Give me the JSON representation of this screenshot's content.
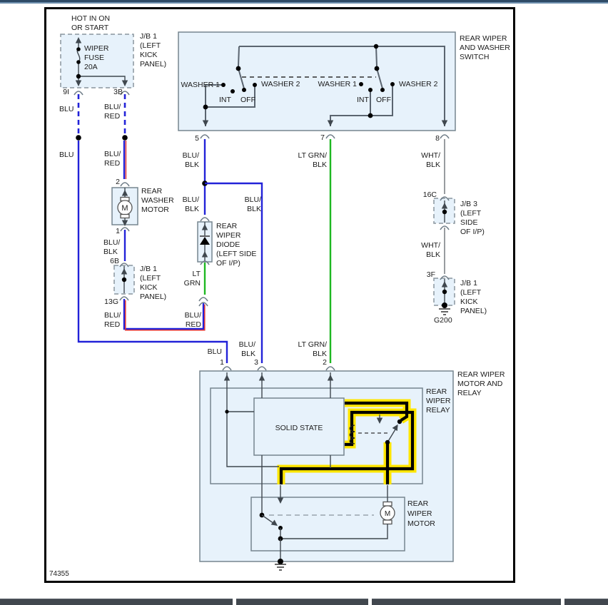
{
  "chrome": {
    "figure_number": "74355",
    "top_bar_color": "#2e4a66",
    "bottom_bar_color": "#41474e"
  },
  "colors": {
    "blu": "#2222d8",
    "red": "#e03434",
    "lt_grn": "#1eb822",
    "wht_blk": "#8c9196",
    "highlight_yellow": "#ffe600",
    "box_fill": "#e7f2fb",
    "box_stroke": "#76858f"
  },
  "power_source": {
    "note": [
      "HOT IN ON",
      "OR START"
    ],
    "fuse_label": [
      "WIPER",
      "FUSE",
      "20A"
    ],
    "block_label": [
      "J/B 1",
      "(LEFT",
      "KICK",
      "PANEL)"
    ],
    "pin_left": "9I",
    "pin_right": "3B"
  },
  "switch": {
    "title": [
      "REAR WIPER",
      "AND WASHER",
      "SWITCH"
    ],
    "left": {
      "washer1": "WASHER 1",
      "int": "INT",
      "off": "OFF",
      "washer2": "WASHER 2"
    },
    "right": {
      "washer1": "WASHER 1",
      "int": "INT",
      "off": "OFF",
      "washer2": "WASHER 2"
    },
    "pin5": "5",
    "pin7": "7",
    "pin8": "8"
  },
  "washer_motor": {
    "label": [
      "REAR",
      "WASHER",
      "MOTOR"
    ],
    "motor_letter": "M",
    "pin_top": "2",
    "pin_bottom": "1"
  },
  "jb1_mid": {
    "label": [
      "J/B 1",
      "(LEFT",
      "KICK",
      "PANEL)"
    ],
    "pin_top": "6B",
    "pin_bottom": "13G"
  },
  "diode": {
    "label": [
      "REAR",
      "WIPER",
      "DIODE",
      "(LEFT SIDE",
      "OF I/P)"
    ]
  },
  "jb3": {
    "label": [
      "J/B 3",
      "(LEFT",
      "SIDE",
      "OF I/P)"
    ],
    "pin_top": "16C"
  },
  "jb1_right": {
    "label": [
      "J/B 1",
      "(LEFT",
      "KICK",
      "PANEL)"
    ],
    "pin_top": "3F",
    "ground": "G200"
  },
  "relay_unit": {
    "title": [
      "REAR WIPER",
      "MOTOR AND",
      "RELAY"
    ],
    "relay_label": [
      "REAR",
      "WIPER",
      "RELAY"
    ],
    "solid_state": "SOLID STATE",
    "motor_label": [
      "REAR",
      "WIPER",
      "MOTOR"
    ],
    "motor_letter": "M",
    "pin1": "1",
    "pin3": "3",
    "pin2": "2"
  },
  "wire_labels": {
    "blu_top": "BLU",
    "blu_red_top": [
      "BLU/",
      "RED"
    ],
    "blu_mid": "BLU",
    "blu_red_mid": [
      "BLU/",
      "RED"
    ],
    "blu_blk_washer": [
      "BLU/",
      "BLK"
    ],
    "blu_red_13g": [
      "BLU/",
      "RED"
    ],
    "blu_red_conn": [
      "BLU/",
      "RED"
    ],
    "lt_grn": [
      "LT",
      "GRN"
    ],
    "blu_blk_pin5": [
      "BLU/",
      "BLK"
    ],
    "blu_blk_splice": [
      "BLU/",
      "BLK"
    ],
    "blu_blk_branch": [
      "BLU/",
      "BLK"
    ],
    "lt_grn_blk_pin7": [
      "LT GRN/",
      "BLK"
    ],
    "wht_blk_pin8": [
      "WHT/",
      "BLK"
    ],
    "wht_blk_mid": [
      "WHT/",
      "BLK"
    ],
    "blu_relay": "BLU",
    "blu_blk_relay": [
      "BLU/",
      "BLK"
    ],
    "lt_grn_blk_relay": [
      "LT GRN/",
      "BLK"
    ]
  }
}
